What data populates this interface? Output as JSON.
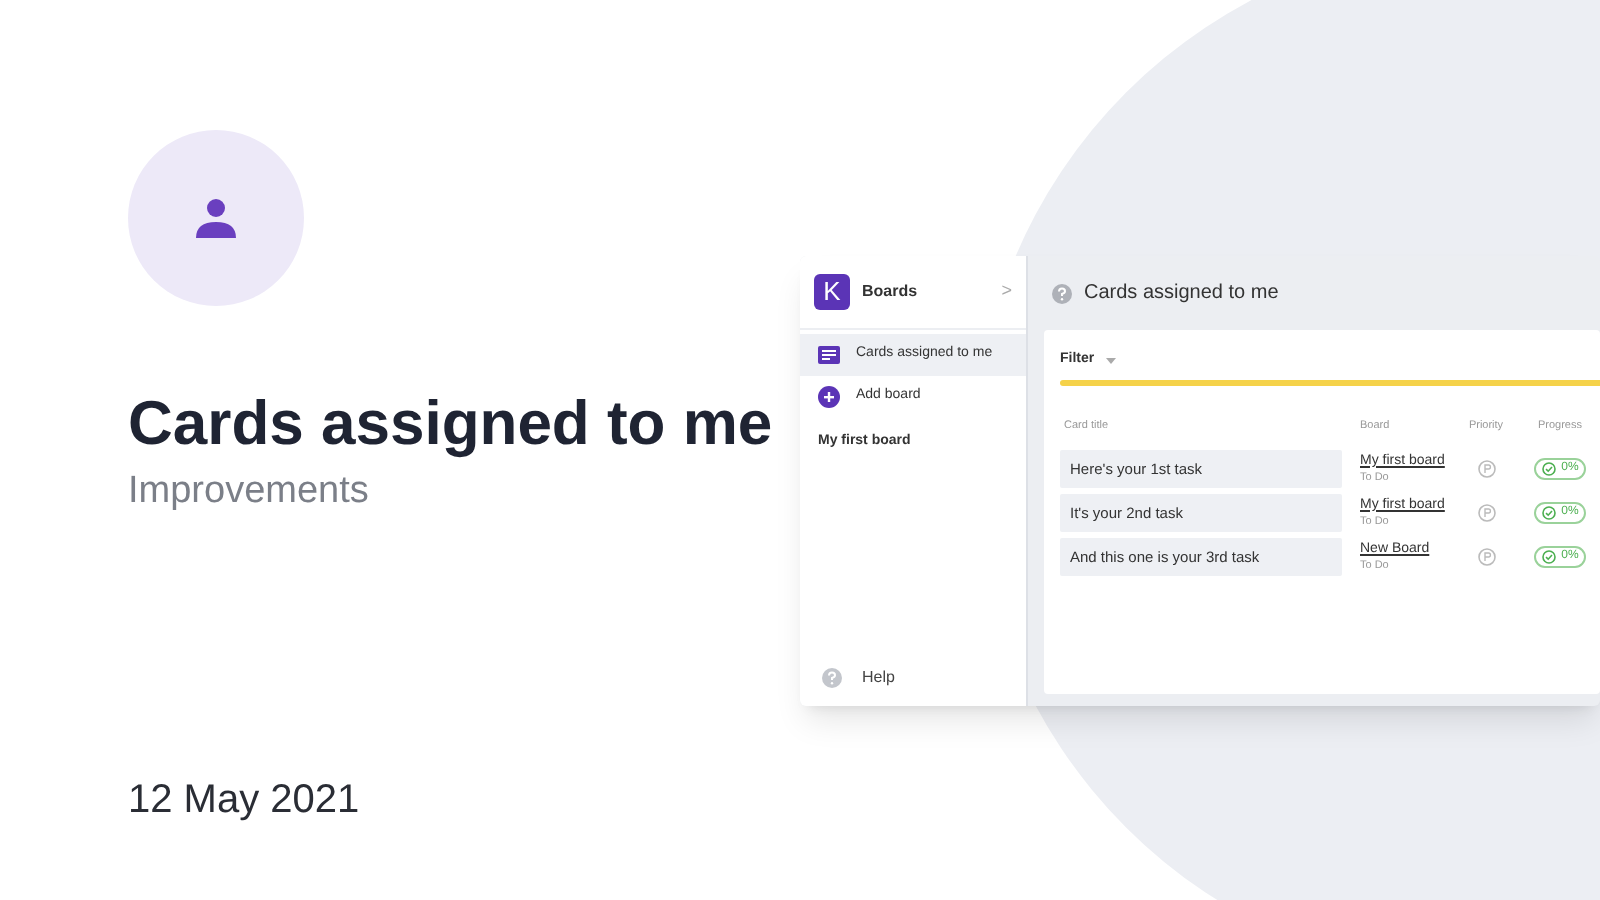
{
  "announcement": {
    "title": "Cards assigned to me",
    "category": "Improvements",
    "date": "12 May 2021"
  },
  "app": {
    "sidebar": {
      "header": {
        "logo": "K",
        "title": "Boards",
        "chevron": ">"
      },
      "items": [
        {
          "kind": "nav",
          "label": "Cards assigned to me",
          "selected": true
        },
        {
          "kind": "action",
          "label": "Add board",
          "selected": false
        },
        {
          "kind": "board",
          "label": "My first board",
          "selected": false
        }
      ],
      "help": "Help"
    },
    "page_title": "Cards assigned to me",
    "filter": {
      "label": "Filter"
    },
    "table": {
      "columns": [
        "Card title",
        "Board",
        "Priority",
        "Progress"
      ],
      "rows": [
        {
          "title": "Here's your 1st task",
          "board": "My first board",
          "list": "To Do",
          "progress": "0%"
        },
        {
          "title": "It's your 2nd task",
          "board": "My first board",
          "list": "To Do",
          "progress": "0%"
        },
        {
          "title": "And this one is your 3rd task",
          "board": "New Board",
          "list": "To Do",
          "progress": "0%"
        }
      ]
    }
  }
}
